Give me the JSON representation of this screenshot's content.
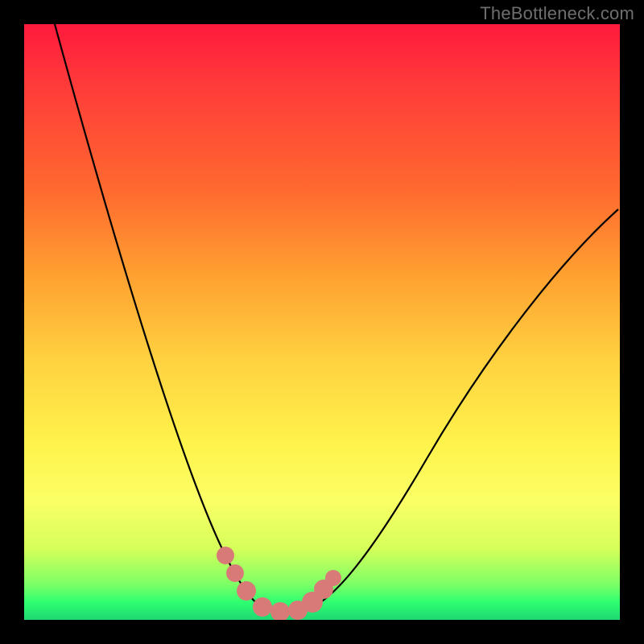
{
  "watermark": {
    "text": "TheBottleneck.com"
  },
  "chart_data": {
    "type": "line",
    "title": "",
    "xlabel": "",
    "ylabel": "",
    "xlim": [
      0,
      100
    ],
    "ylim": [
      0,
      100
    ],
    "series": [
      {
        "name": "bottleneck-curve",
        "x": [
          5,
          10,
          15,
          20,
          25,
          30,
          33,
          36,
          38,
          40,
          42,
          45,
          48,
          55,
          65,
          75,
          85,
          95,
          100
        ],
        "y": [
          100,
          82,
          64,
          47,
          30,
          16,
          8,
          3,
          1,
          0,
          0,
          1,
          3,
          8,
          18,
          30,
          43,
          57,
          65
        ]
      },
      {
        "name": "highlight-dots",
        "x": [
          33,
          35,
          37,
          40,
          43,
          45,
          47
        ],
        "y": [
          6,
          3,
          1,
          0,
          0,
          1,
          3
        ]
      }
    ],
    "gradient_stops": [
      {
        "pos": 0,
        "color": "#ff1a3c"
      },
      {
        "pos": 50,
        "color": "#ffd040"
      },
      {
        "pos": 80,
        "color": "#fbff66"
      },
      {
        "pos": 100,
        "color": "#1ed873"
      }
    ]
  }
}
